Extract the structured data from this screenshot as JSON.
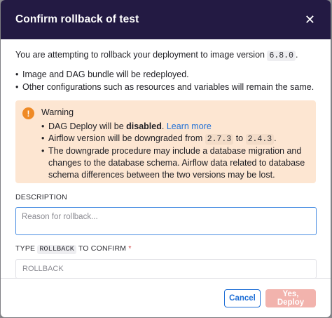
{
  "dialog": {
    "title": "Confirm rollback of test",
    "close_glyph": "✕"
  },
  "intro": {
    "prefix": "You are attempting to rollback your deployment to image version ",
    "version": "6.8.0",
    "suffix": "."
  },
  "points": [
    "Image and DAG bundle will be redeployed.",
    "Other configurations such as resources and variables will remain the same."
  ],
  "warning": {
    "icon_glyph": "!",
    "title": "Warning",
    "item1_prefix": "DAG Deploy will be ",
    "item1_bold": "disabled",
    "item1_suffix": ".",
    "item1_link": "Learn more",
    "item2_prefix": "Airflow version will be downgraded from ",
    "item2_from": "2.7.3",
    "item2_mid": " to ",
    "item2_to": "2.4.3",
    "item2_suffix": ".",
    "item3": "The downgrade procedure may include a database migration and changes to the database schema. Airflow data related to database schema differences between the two versions may be lost."
  },
  "description": {
    "label": "DESCRIPTION",
    "placeholder": "Reason for rollback...",
    "value": ""
  },
  "confirm": {
    "label_prefix": "TYPE ",
    "label_code": "ROLLBACK",
    "label_suffix": " TO CONFIRM",
    "required_mark": "*",
    "placeholder": "ROLLBACK",
    "value": ""
  },
  "footer": {
    "cancel_label": "Cancel",
    "deploy_label": "Yes, Deploy"
  },
  "colors": {
    "header_bg": "#231a43",
    "warning_bg": "#fde6d2",
    "warning_icon": "#ef8a26",
    "link": "#1f6fd6",
    "deploy_disabled": "#f2b3ad",
    "focus_border": "#4b8fe2"
  },
  "icons": {
    "close": "close-icon",
    "warning": "warning-icon"
  }
}
